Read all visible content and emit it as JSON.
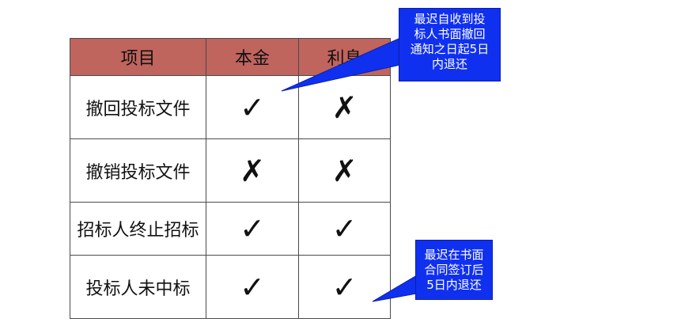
{
  "table": {
    "headers": [
      "项目",
      "本金",
      "利息"
    ],
    "rows": [
      {
        "item": "撤回投标文件",
        "principal": "✓",
        "interest": "✗"
      },
      {
        "item": "撤销投标文件",
        "principal": "✗",
        "interest": "✗"
      },
      {
        "item": "招标人终止招标",
        "principal": "✓",
        "interest": "✓"
      },
      {
        "item": "投标人未中标",
        "principal": "✓",
        "interest": "✓"
      }
    ]
  },
  "callouts": {
    "first": "最迟自收到投\n标人书面撤回\n通知之日起5日\n内退还",
    "second": "最迟在书面\n合同签订后\n5日内退还"
  },
  "colors": {
    "header_bg": "#c0645e",
    "callout_bg": "#1030f0"
  }
}
